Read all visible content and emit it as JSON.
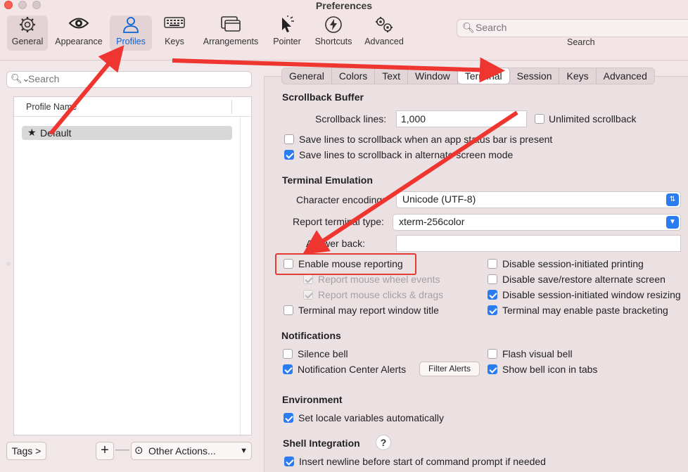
{
  "window": {
    "title": "Preferences"
  },
  "toolbar": {
    "items": [
      {
        "label": "General",
        "icon": "gear-icon"
      },
      {
        "label": "Appearance",
        "icon": "eye-icon"
      },
      {
        "label": "Profiles",
        "icon": "person-icon"
      },
      {
        "label": "Keys",
        "icon": "keyboard-icon"
      },
      {
        "label": "Arrangements",
        "icon": "windows-icon"
      },
      {
        "label": "Pointer",
        "icon": "pointer-icon"
      },
      {
        "label": "Shortcuts",
        "icon": "bolt-icon"
      },
      {
        "label": "Advanced",
        "icon": "gears-icon"
      }
    ],
    "search_placeholder": "Search",
    "search_caption": "Search"
  },
  "profiles": {
    "search_placeholder": "Search",
    "column_header": "Profile Name",
    "rows": [
      {
        "name": "Default",
        "default": true
      }
    ],
    "tags_button": "Tags >",
    "add_button": "+",
    "remove_button": "—",
    "other_actions": "Other Actions..."
  },
  "tabs": [
    "General",
    "Colors",
    "Text",
    "Window",
    "Terminal",
    "Session",
    "Keys",
    "Advanced"
  ],
  "active_tab": "Terminal",
  "scrollback": {
    "heading": "Scrollback Buffer",
    "lines_label": "Scrollback lines:",
    "lines_value": "1,000",
    "unlimited_label": "Unlimited scrollback",
    "save_status_bar_label": "Save lines to scrollback when an app status bar is present",
    "save_alternate_label": "Save lines to scrollback in alternate screen mode"
  },
  "emulation": {
    "heading": "Terminal Emulation",
    "encoding_label": "Character encoding:",
    "encoding_value": "Unicode (UTF-8)",
    "report_type_label": "Report terminal type:",
    "report_type_value": "xterm-256color",
    "answer_back_label": "Answer back:",
    "answer_back_value": "",
    "mouse_reporting_label": "Enable mouse reporting",
    "mouse_wheel_label": "Report mouse wheel events",
    "mouse_clicks_label": "Report mouse clicks & drags",
    "report_title_label": "Terminal may report window title",
    "disable_printing_label": "Disable session-initiated printing",
    "disable_alt_screen_label": "Disable save/restore alternate screen",
    "disable_resize_label": "Disable session-initiated window resizing",
    "paste_bracketing_label": "Terminal may enable paste bracketing"
  },
  "notifications": {
    "heading": "Notifications",
    "silence_bell_label": "Silence bell",
    "flash_bell_label": "Flash visual bell",
    "center_alerts_label": "Notification Center Alerts",
    "filter_alerts_button": "Filter Alerts",
    "bell_icon_label": "Show bell icon in tabs"
  },
  "environment": {
    "heading": "Environment",
    "locale_label": "Set locale variables automatically"
  },
  "shell_integration": {
    "heading": "Shell Integration",
    "help_button": "?",
    "newline_label": "Insert newline before start of command prompt if needed"
  },
  "colors": {
    "accent": "#2b7cf0",
    "annotation_red": "#e53b36",
    "selected_tool_text": "#0a63d6"
  }
}
